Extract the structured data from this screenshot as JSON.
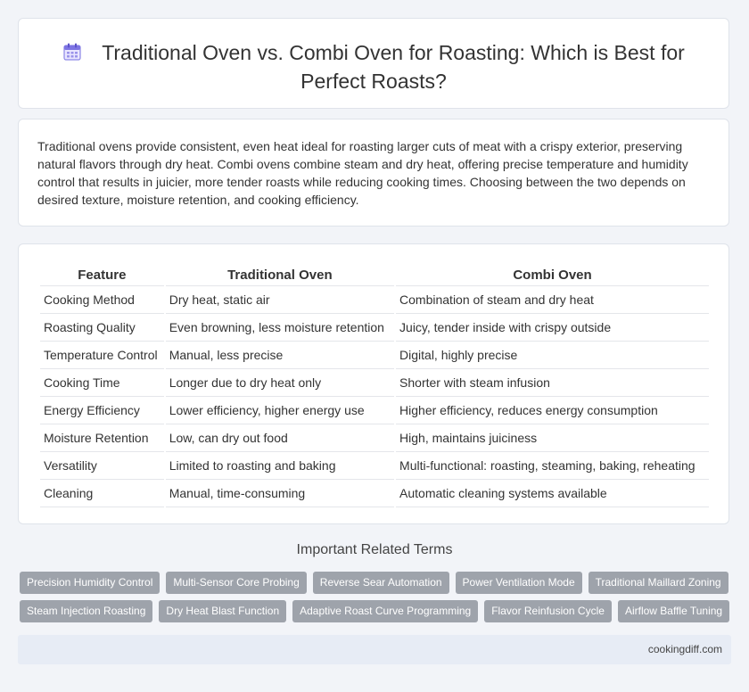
{
  "header": {
    "title": "Traditional Oven vs. Combi Oven for Roasting: Which is Best for Perfect Roasts?",
    "icon": "calendar-icon"
  },
  "intro": {
    "text": "Traditional ovens provide consistent, even heat ideal for roasting larger cuts of meat with a crispy exterior, preserving natural flavors through dry heat. Combi ovens combine steam and dry heat, offering precise temperature and humidity control that results in juicier, more tender roasts while reducing cooking times. Choosing between the two depends on desired texture, moisture retention, and cooking efficiency."
  },
  "table": {
    "headers": [
      "Feature",
      "Traditional Oven",
      "Combi Oven"
    ],
    "rows": [
      [
        "Cooking Method",
        "Dry heat, static air",
        "Combination of steam and dry heat"
      ],
      [
        "Roasting Quality",
        "Even browning, less moisture retention",
        "Juicy, tender inside with crispy outside"
      ],
      [
        "Temperature Control",
        "Manual, less precise",
        "Digital, highly precise"
      ],
      [
        "Cooking Time",
        "Longer due to dry heat only",
        "Shorter with steam infusion"
      ],
      [
        "Energy Efficiency",
        "Lower efficiency, higher energy use",
        "Higher efficiency, reduces energy consumption"
      ],
      [
        "Moisture Retention",
        "Low, can dry out food",
        "High, maintains juiciness"
      ],
      [
        "Versatility",
        "Limited to roasting and baking",
        "Multi-functional: roasting, steaming, baking, reheating"
      ],
      [
        "Cleaning",
        "Manual, time-consuming",
        "Automatic cleaning systems available"
      ]
    ]
  },
  "related": {
    "title": "Important Related Terms",
    "row1": [
      "Precision Humidity Control",
      "Multi-Sensor Core Probing",
      "Reverse Sear Automation",
      "Power Ventilation Mode",
      "Traditional Maillard Zoning"
    ],
    "row2": [
      "Steam Injection Roasting",
      "Dry Heat Blast Function",
      "Adaptive Roast Curve Programming",
      "Flavor Reinfusion Cycle",
      "Airflow Baffle Tuning"
    ]
  },
  "footer": {
    "site": "cookingdiff.com"
  },
  "colors": {
    "tag_bg": "#9ea3ab",
    "footer_bg": "#e7ecf5",
    "page_bg": "#f2f4f8"
  }
}
